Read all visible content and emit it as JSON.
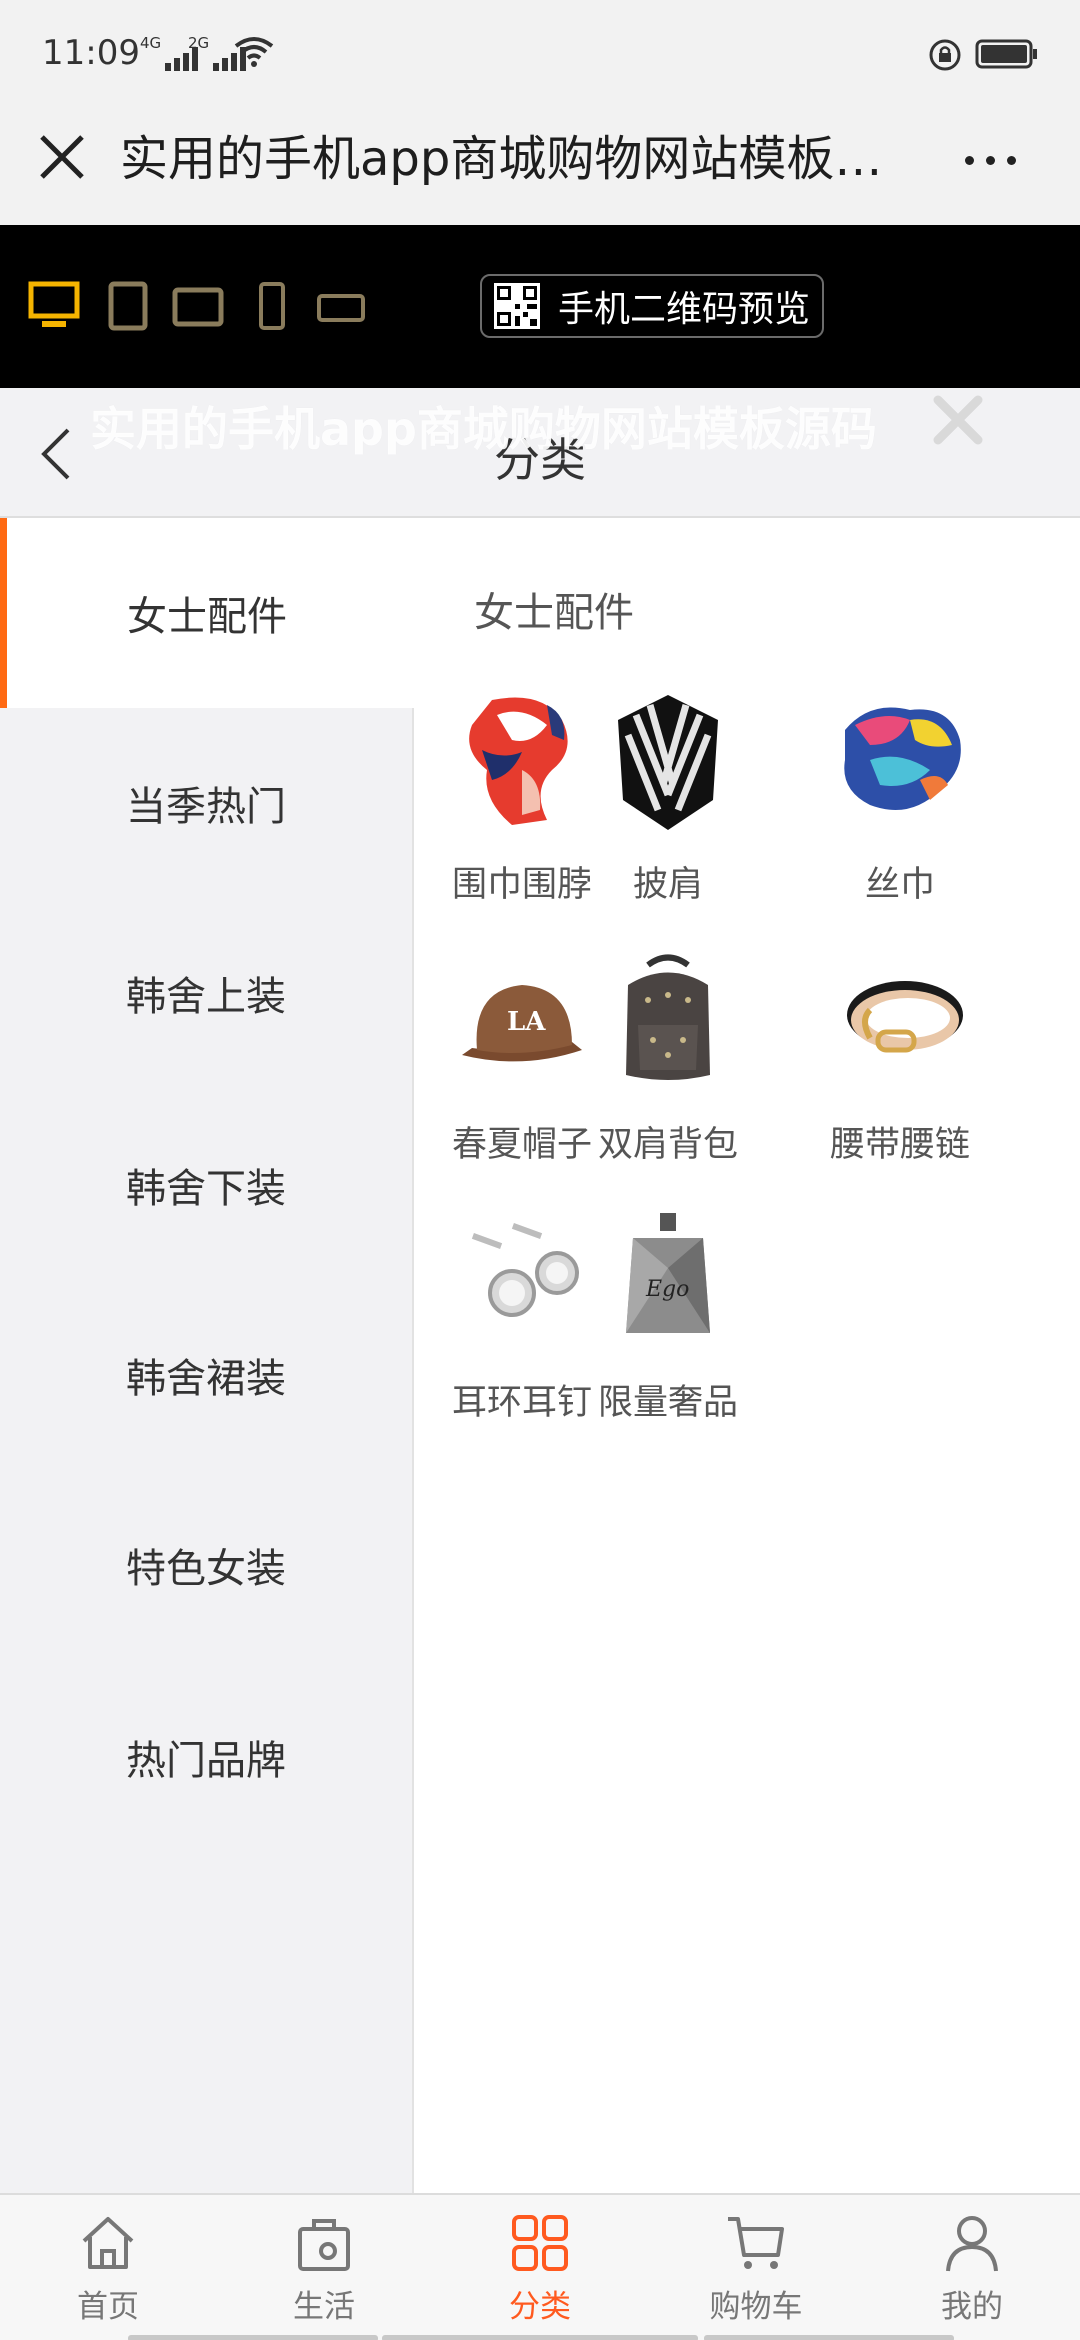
{
  "status_bar": {
    "time": "11:09",
    "network1": "4G",
    "network2": "2G",
    "icons": [
      "wifi-icon",
      "lock-rotation-icon",
      "battery-icon"
    ]
  },
  "browser": {
    "title": "实用的手机app商城购物网站模板源码",
    "close_icon": "close-icon",
    "more_icon": "more-icon"
  },
  "preview_toolbar": {
    "devices": [
      "desktop-icon",
      "tablet-icon",
      "tablet-landscape-icon",
      "phone-icon",
      "phone-landscape-icon"
    ],
    "active_color": "#f5b400",
    "qr_button_label": "手机二维码预览"
  },
  "page_header": {
    "title": "分类",
    "overlay_title": "实用的手机app商城购物网站模板源码"
  },
  "sidebar": {
    "accent": "#ff6a13",
    "items": [
      {
        "label": "女士配件",
        "active": true
      },
      {
        "label": "当季热门"
      },
      {
        "label": "韩舍上装"
      },
      {
        "label": "韩舍下装"
      },
      {
        "label": "韩舍裙装"
      },
      {
        "label": "特色女装"
      },
      {
        "label": "热门品牌"
      }
    ]
  },
  "content": {
    "heading": "女士配件",
    "products": [
      {
        "label": "围巾围脖"
      },
      {
        "label": "披肩"
      },
      {
        "label": "丝巾"
      },
      {
        "label": "春夏帽子"
      },
      {
        "label": "双肩背包"
      },
      {
        "label": "腰带腰链"
      },
      {
        "label": "耳环耳钉"
      },
      {
        "label": "限量奢品"
      }
    ]
  },
  "bottom_nav": {
    "active_color": "#ff5a1f",
    "items": [
      {
        "label": "首页",
        "icon": "home-icon"
      },
      {
        "label": "生活",
        "icon": "life-bag-icon"
      },
      {
        "label": "分类",
        "icon": "category-grid-icon",
        "active": true
      },
      {
        "label": "购物车",
        "icon": "cart-icon"
      },
      {
        "label": "我的",
        "icon": "user-icon"
      }
    ]
  }
}
